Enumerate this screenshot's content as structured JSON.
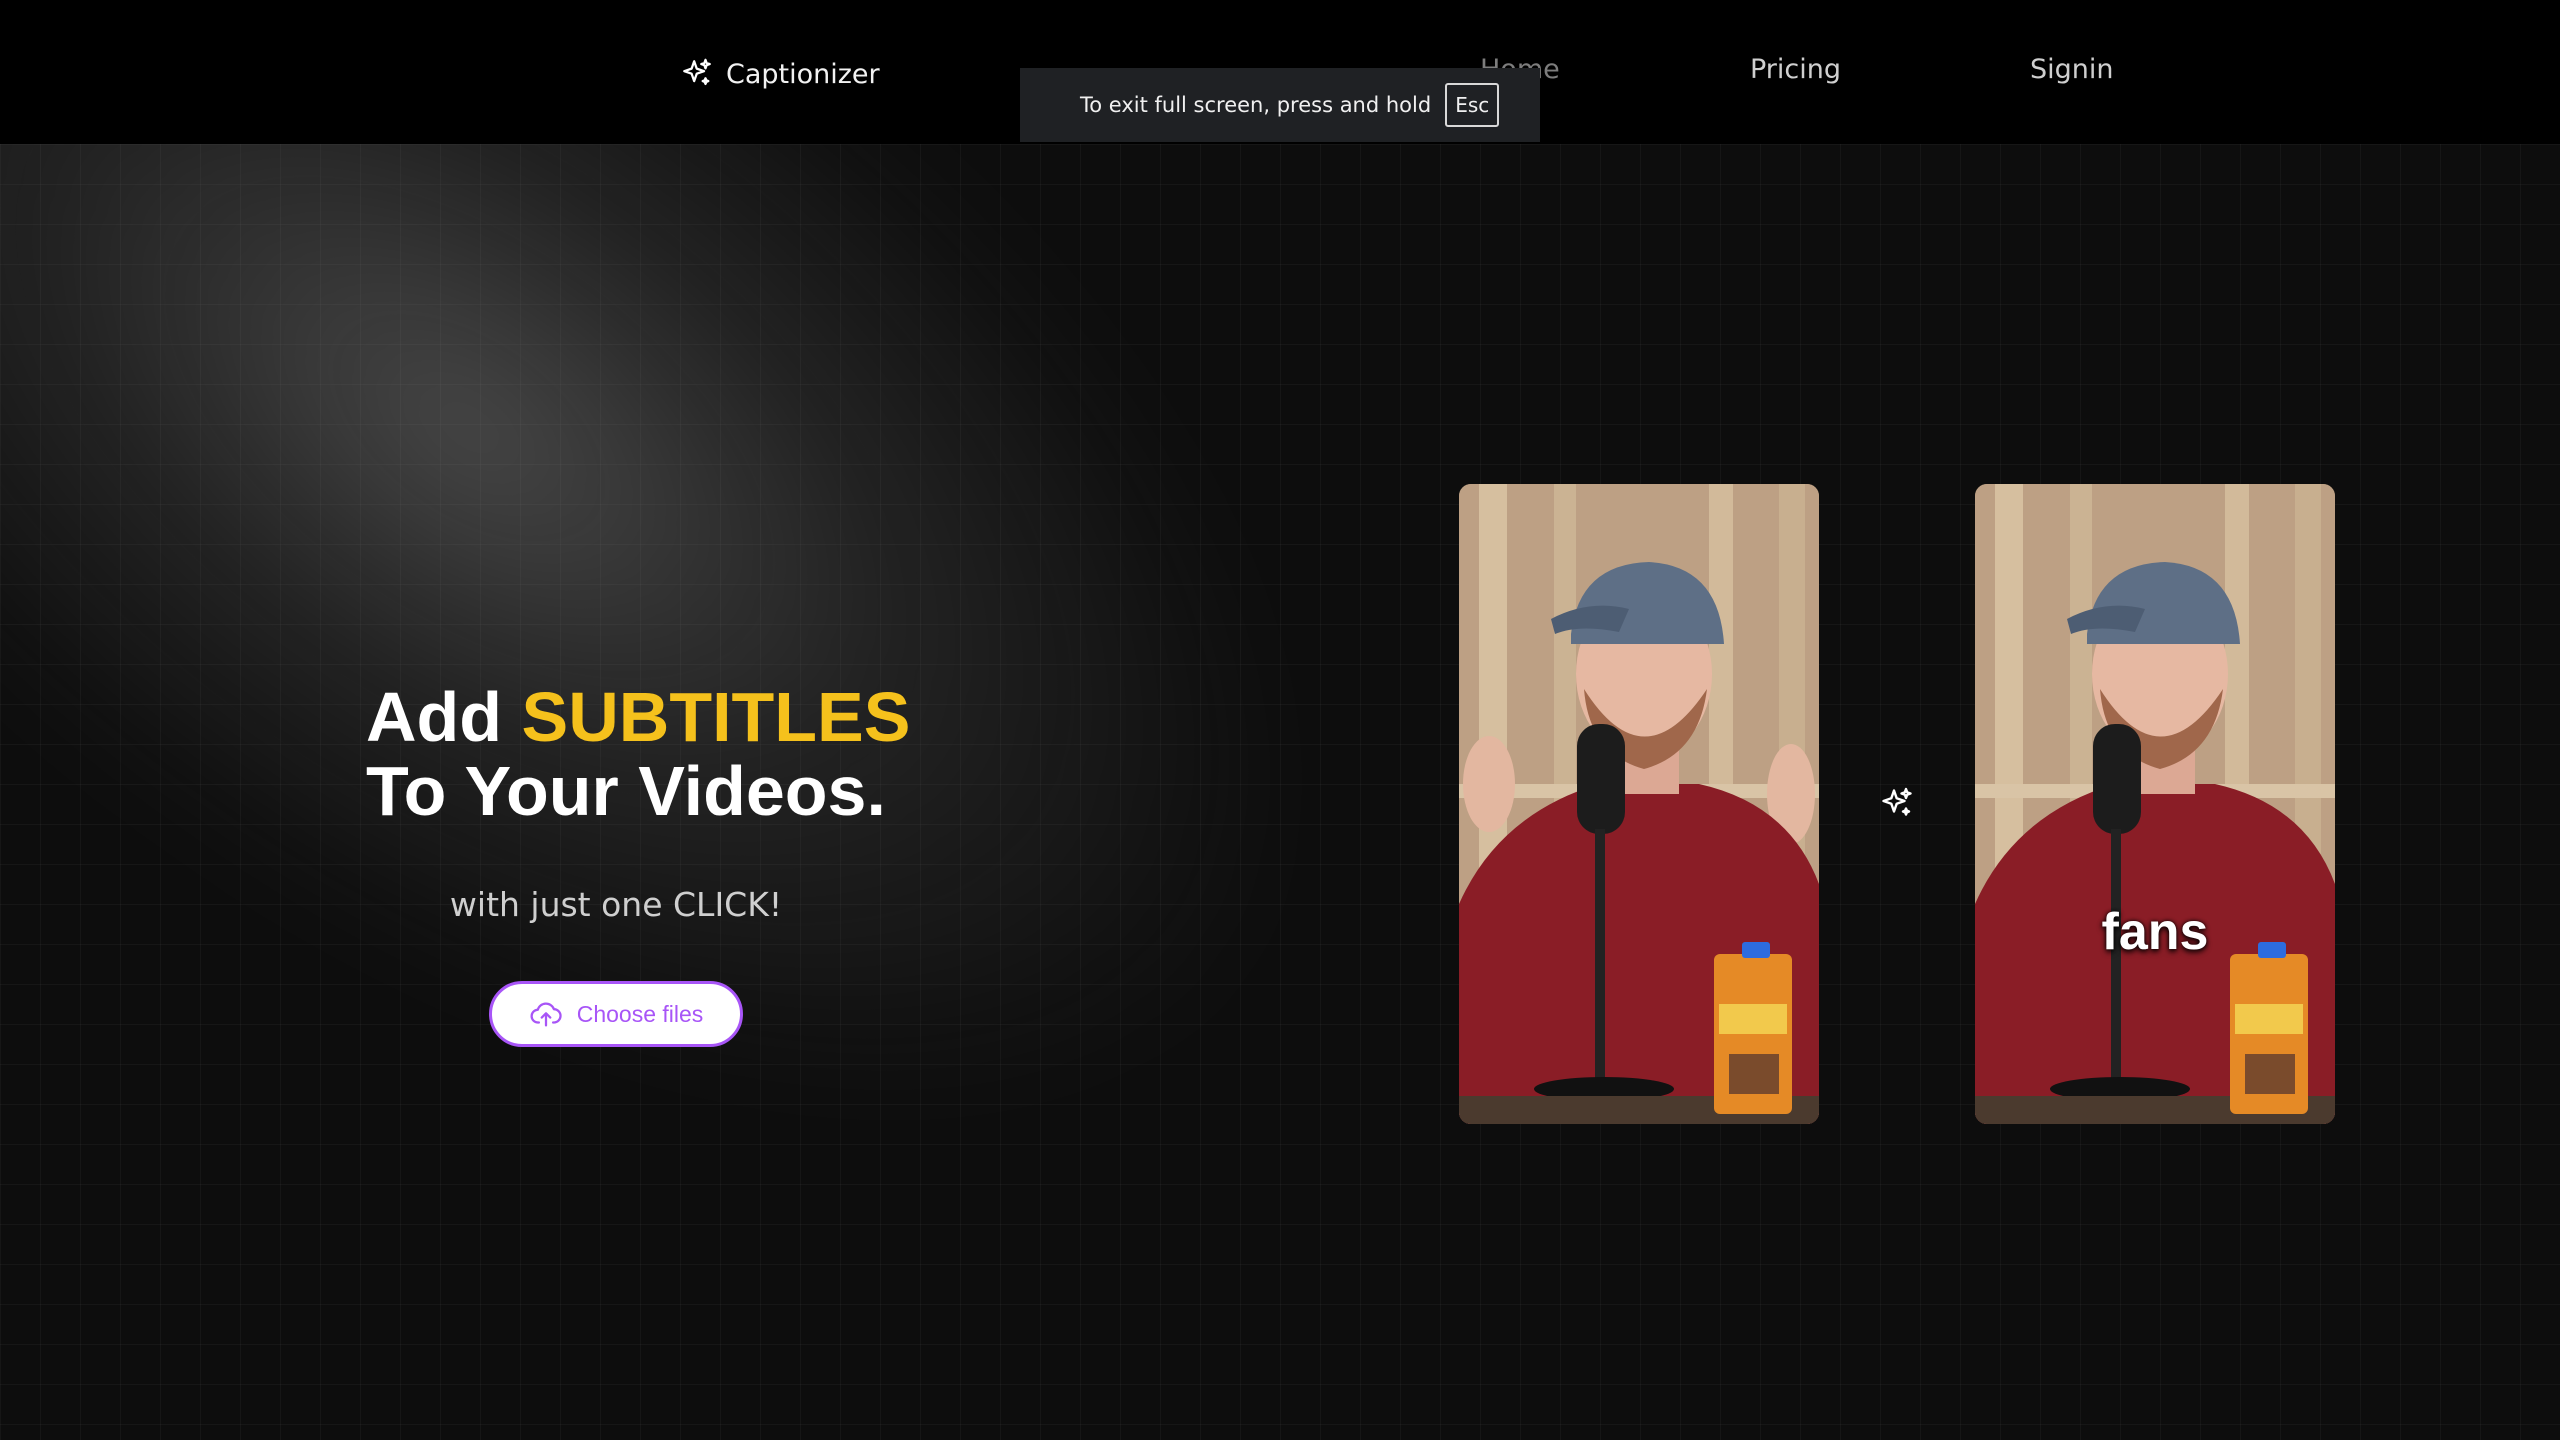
{
  "nav": {
    "brand": "Captionizer",
    "links": [
      {
        "label": "Home"
      },
      {
        "label": "Pricing"
      },
      {
        "label": "Signin"
      }
    ]
  },
  "fullscreen_notice": {
    "message": "To exit full screen, press and hold",
    "key": "Esc"
  },
  "hero": {
    "headline_prefix": "Add ",
    "headline_accent": "SUBTITLES",
    "headline_line2": "To Your Videos.",
    "subline": "with just one CLICK!",
    "upload_button": "Choose files"
  },
  "preview": {
    "after_caption": "fans"
  },
  "colors": {
    "accent_yellow": "#f5c11c",
    "button_purple": "#a855f7",
    "background": "#0d0d0d"
  },
  "icons": {
    "brand": "sparkles-icon",
    "upload": "cloud-upload-icon",
    "transform": "sparkles-icon"
  }
}
